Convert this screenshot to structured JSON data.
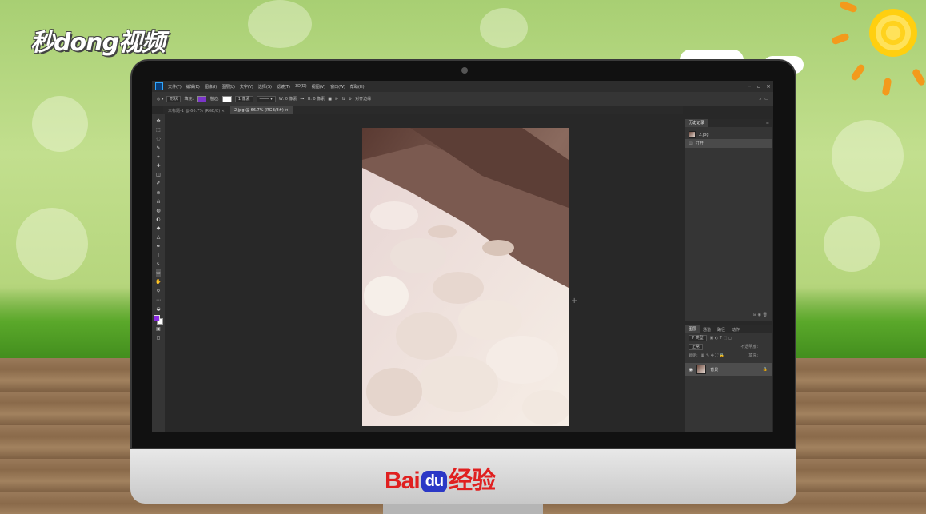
{
  "watermark": {
    "channel": "秒dong视频",
    "brand_bai": "Bai",
    "brand_du": "du",
    "brand_jingyan": "经验"
  },
  "photoshop": {
    "menu": [
      "文件(F)",
      "编辑(E)",
      "图像(I)",
      "图层(L)",
      "文字(Y)",
      "选择(S)",
      "滤镜(T)",
      "3D(D)",
      "视图(V)",
      "窗口(W)",
      "帮助(H)"
    ],
    "window_controls": [
      "─",
      "▫",
      "✕"
    ],
    "options": {
      "mode": "形状",
      "fill_label": "填充:",
      "fill_color": "#7b35c9",
      "stroke_label": "描边:",
      "stroke_width": "1 像素",
      "w_label": "W: 0 像素",
      "h_label": "H: 0 像素",
      "align_edges": "对齐边缘",
      "search_icon": "⌕"
    },
    "tabs": [
      {
        "label": "未标题-1 @ 66.7% (RGB/8)",
        "close": "×"
      },
      {
        "label": "2.jpg @ 66.7% (RGB/8#)",
        "close": "×"
      }
    ],
    "tools": [
      "✥",
      "⬚",
      "◌",
      "✎",
      "⌗",
      "✚",
      "◫",
      "✐",
      "⊘",
      "⎌",
      "◍",
      "◐",
      "◆",
      "△",
      "✒",
      "T",
      "↖",
      "▭",
      "✋",
      "⚲",
      "⋯",
      "◒",
      "▣",
      "◻"
    ],
    "history_panel": {
      "title": "历史记录",
      "snapshot": "2.jpg",
      "items": [
        "打开"
      ]
    },
    "layers_panel": {
      "tabs": [
        "图层",
        "通道",
        "路径",
        "动作"
      ],
      "filter": "P 类型",
      "blend_mode": "正常",
      "opacity_label": "不透明度:",
      "lock_label": "锁定:",
      "fill_label": "填充:",
      "layer_name": "背景"
    }
  }
}
